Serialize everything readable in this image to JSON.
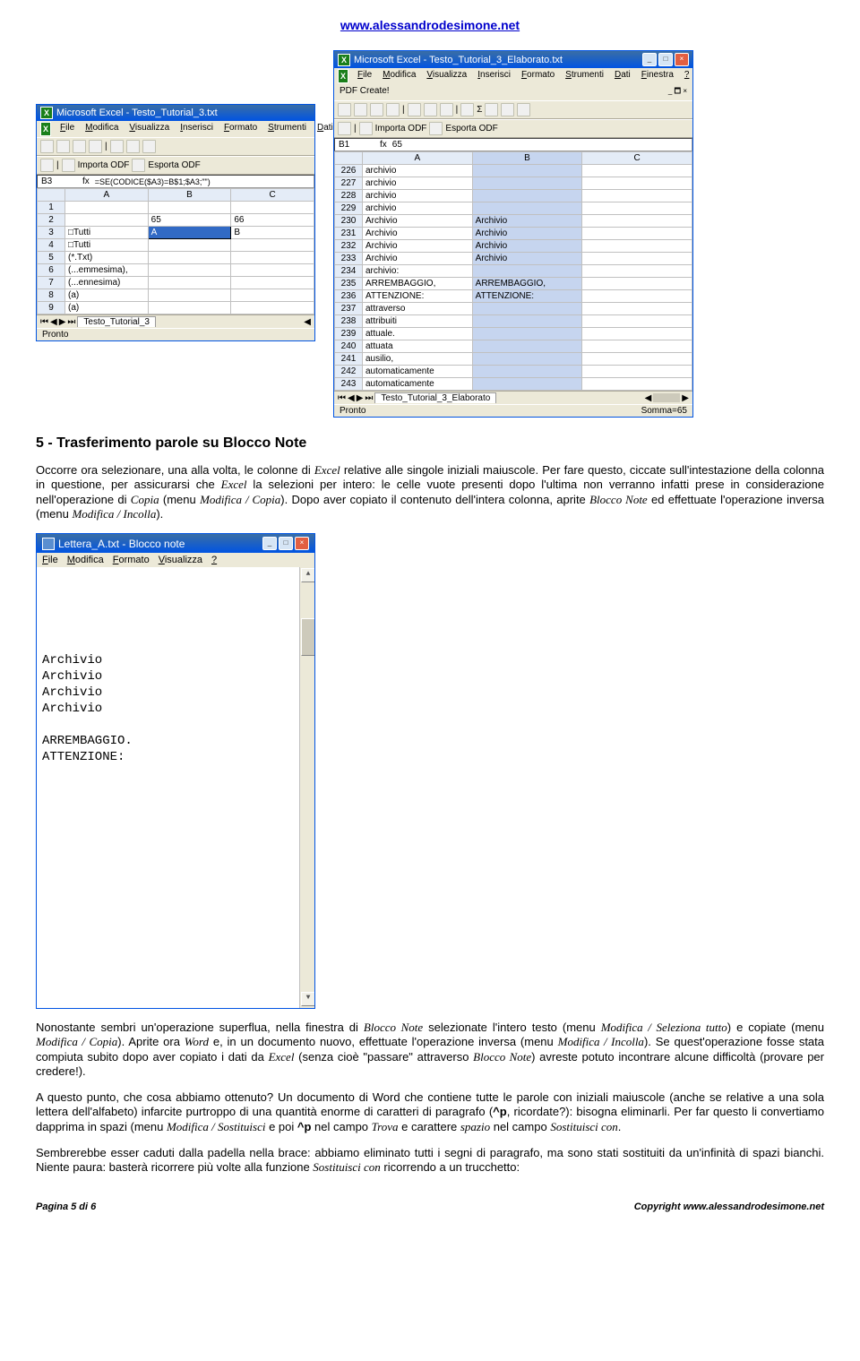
{
  "header_link": "www.alessandrodesimone.net",
  "excel_left": {
    "title": "Microsoft Excel - Testo_Tutorial_3.txt",
    "menus": [
      "File",
      "Modifica",
      "Visualizza",
      "Inserisci",
      "Formato",
      "Strumenti",
      "Dati"
    ],
    "toolbar2": [
      "Importa ODF",
      "Esporta ODF"
    ],
    "namebox": "B3",
    "formula": "=SE(CODICE($A3)=B$1;$A3;\"\")",
    "cols": [
      "",
      "A",
      "B",
      "C"
    ],
    "rows": [
      [
        "1",
        "",
        "",
        ""
      ],
      [
        "2",
        "",
        "65",
        "66"
      ],
      [
        "3",
        "□Tutti",
        "A",
        "B"
      ],
      [
        "4",
        "□Tutti",
        "",
        ""
      ],
      [
        "5",
        "(*.Txt)",
        "",
        ""
      ],
      [
        "6",
        "(...emmesima),",
        "",
        ""
      ],
      [
        "7",
        "(...ennesima)",
        "",
        ""
      ],
      [
        "8",
        "(a)",
        "",
        ""
      ],
      [
        "9",
        "(a)",
        "",
        ""
      ]
    ],
    "sel_row": 2,
    "sel_col": 2,
    "sheet": "Testo_Tutorial_3",
    "status": "Pronto"
  },
  "excel_right": {
    "title": "Microsoft Excel - Testo_Tutorial_3_Elaborato.txt",
    "menus": [
      "File",
      "Modifica",
      "Visualizza",
      "Inserisci",
      "Formato",
      "Strumenti",
      "Dati",
      "Finestra",
      "?"
    ],
    "pdf": "PDF Create!",
    "toolbar2": [
      "Importa ODF",
      "Esporta ODF"
    ],
    "namebox": "B1",
    "formula": "65",
    "cols": [
      "",
      "A",
      "B",
      "C"
    ],
    "rows": [
      [
        "226",
        "archivio",
        "",
        ""
      ],
      [
        "227",
        "archivio",
        "",
        ""
      ],
      [
        "228",
        "archivio",
        "",
        ""
      ],
      [
        "229",
        "archivio",
        "",
        ""
      ],
      [
        "230",
        "Archivio",
        "Archivio",
        ""
      ],
      [
        "231",
        "Archivio",
        "Archivio",
        ""
      ],
      [
        "232",
        "Archivio",
        "Archivio",
        ""
      ],
      [
        "233",
        "Archivio",
        "Archivio",
        ""
      ],
      [
        "234",
        "archivio:",
        "",
        ""
      ],
      [
        "235",
        "ARREMBAGGIO,",
        "ARREMBAGGIO,",
        ""
      ],
      [
        "236",
        "ATTENZIONE:",
        "ATTENZIONE:",
        ""
      ],
      [
        "237",
        "attraverso",
        "",
        ""
      ],
      [
        "238",
        "attribuiti",
        "",
        ""
      ],
      [
        "239",
        "attuale.",
        "",
        ""
      ],
      [
        "240",
        "attuata",
        "",
        ""
      ],
      [
        "241",
        "ausilio,",
        "",
        ""
      ],
      [
        "242",
        "automaticamente",
        "",
        ""
      ],
      [
        "243",
        "automaticamente",
        "",
        ""
      ]
    ],
    "sel_col": 2,
    "sheet": "Testo_Tutorial_3_Elaborato",
    "status": "Pronto",
    "status_r": "Somma=65"
  },
  "section_title": "5 - Trasferimento parole su Blocco Note",
  "para1a": "Occorre ora selezionare, una alla volta, le colonne di ",
  "para1b": "Excel",
  "para1c": " relative alle singole iniziali maiuscole. Per fare questo, ciccate sull'intestazione della colonna in questione, per assicurarsi che ",
  "para1d": "Excel",
  "para1e": " la selezioni per intero: le celle vuote presenti dopo l'ultima non verranno infatti prese in considerazione nell'operazione di ",
  "para1f": "Copia",
  "para1g": " (menu ",
  "para1h": "Modifica / Copia",
  "para1i": "). Dopo aver copiato il contenuto dell'intera colonna, aprite ",
  "para1j": "Blocco Note",
  "para1k": " ed effettuate l'operazione inversa (menu ",
  "para1l": "Modifica / Incolla",
  "para1m": ").",
  "notepad": {
    "title": "Lettera_A.txt - Blocco note",
    "menus": [
      "File",
      "Modifica",
      "Formato",
      "Visualizza",
      "?"
    ],
    "lines": [
      "",
      "",
      "",
      "",
      "",
      "Archivio",
      "Archivio",
      "Archivio",
      "Archivio",
      "",
      "ARREMBAGGIO.",
      "ATTENZIONE:"
    ]
  },
  "para2a": "Nonostante sembri un'operazione superflua, nella finestra di ",
  "para2b": "Blocco Note",
  "para2c": " selezionate l'intero testo (menu ",
  "para2d": "Modifica / Seleziona tutto",
  "para2e": ") e copiate (menu ",
  "para2f": "Modifica / Copia",
  "para2g": "). Aprite ora ",
  "para2h": "Word",
  "para2i": " e, in un documento nuovo, effettuate l'operazione inversa (menu ",
  "para2j": "Modifica / Incolla",
  "para2k": "). Se quest'operazione fosse stata compiuta subito dopo aver copiato i dati da ",
  "para2l": "Excel",
  "para2m": " (senza cioè \"passare\" attraverso ",
  "para2n": "Blocco Note",
  "para2o": ") avreste potuto incontrare alcune difficoltà (provare per credere!).",
  "para3a": "A questo punto, che cosa abbiamo ottenuto? Un documento di Word che contiene tutte le parole con iniziali maiuscole (anche se relative a una sola lettera dell'alfabeto) infarcite purtroppo di una quantità enorme di caratteri di paragrafo (",
  "para3b": "^p",
  "para3c": ", ricordate?): bisogna eliminarli. Per far questo li convertiamo dapprima in spazi (menu ",
  "para3d": "Modifica / Sostituisci",
  "para3e": " e poi ",
  "para3f": "^p",
  "para3g": " nel campo ",
  "para3h": "Trova",
  "para3i": " e carattere ",
  "para3j": "spazio",
  "para3k": " nel campo ",
  "para3l": "Sostituisci con",
  "para3m": ".",
  "para4a": "Sembrerebbe esser caduti dalla padella nella brace: abbiamo eliminato tutti i segni di paragrafo, ma sono stati sostituiti da un'infinità di spazi bianchi. Niente paura: basterà ricorrere più volte alla funzione ",
  "para4b": "Sostituisci con",
  "para4c": " ricorrendo a  un trucchetto:",
  "footer_l": "Pagina 5 di 6",
  "footer_r": "Copyright www.alessandrodesimone.net"
}
